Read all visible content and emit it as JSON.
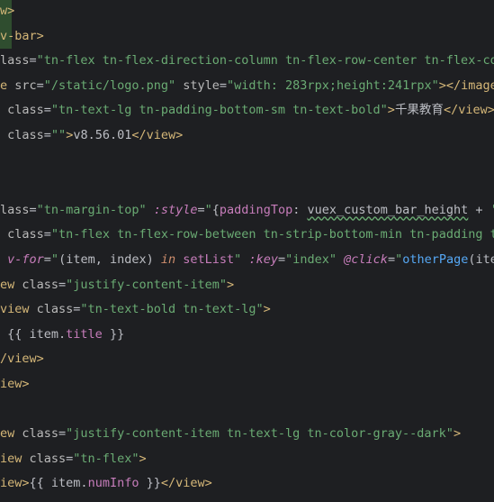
{
  "editor": {
    "lines": [
      {
        "tokens": [
          {
            "t": "w>",
            "c": "tag"
          }
        ]
      },
      {
        "tokens": [
          {
            "t": "v-bar>",
            "c": "tag"
          }
        ]
      },
      {
        "tokens": [
          {
            "t": "lass",
            "c": "attr"
          },
          {
            "t": "=",
            "c": "eq"
          },
          {
            "t": "\"tn-flex tn-flex-direction-column tn-flex-row-center tn-flex-col",
            "c": "str"
          }
        ]
      },
      {
        "tokens": [
          {
            "t": "e ",
            "c": "tag"
          },
          {
            "t": "src",
            "c": "attr"
          },
          {
            "t": "=",
            "c": "eq"
          },
          {
            "t": "\"/static/logo.png\"",
            "c": "str"
          },
          {
            "t": " ",
            "c": "text"
          },
          {
            "t": "style",
            "c": "attr"
          },
          {
            "t": "=",
            "c": "eq"
          },
          {
            "t": "\"width: 283rpx;height:241rpx\"",
            "c": "str"
          },
          {
            "t": "></",
            "c": "tag"
          },
          {
            "t": "image",
            "c": "tag"
          },
          {
            "t": ">",
            "c": "tag"
          }
        ]
      },
      {
        "tokens": [
          {
            "t": " class",
            "c": "attr"
          },
          {
            "t": "=",
            "c": "eq"
          },
          {
            "t": "\"tn-text-lg tn-padding-bottom-sm tn-text-bold\"",
            "c": "str"
          },
          {
            "t": ">",
            "c": "tag"
          },
          {
            "t": "千果教育",
            "c": "text"
          },
          {
            "t": "</",
            "c": "tag"
          },
          {
            "t": "view",
            "c": "tag"
          },
          {
            "t": ">",
            "c": "tag"
          }
        ]
      },
      {
        "tokens": [
          {
            "t": " class",
            "c": "attr"
          },
          {
            "t": "=",
            "c": "eq"
          },
          {
            "t": "\"\"",
            "c": "str"
          },
          {
            "t": ">",
            "c": "tag"
          },
          {
            "t": "v8.56.01",
            "c": "text"
          },
          {
            "t": "</",
            "c": "tag"
          },
          {
            "t": "view",
            "c": "tag"
          },
          {
            "t": ">",
            "c": "tag"
          }
        ]
      },
      {
        "tokens": []
      },
      {
        "tokens": []
      },
      {
        "tokens": [
          {
            "t": "lass",
            "c": "attr"
          },
          {
            "t": "=",
            "c": "eq"
          },
          {
            "t": "\"tn-margin-top\"",
            "c": "str"
          },
          {
            "t": " ",
            "c": "text"
          },
          {
            "t": ":style",
            "c": "vattr"
          },
          {
            "t": "=",
            "c": "eq"
          },
          {
            "t": "\"",
            "c": "str"
          },
          {
            "t": "{",
            "c": "punc"
          },
          {
            "t": "paddingTop",
            "c": "var"
          },
          {
            "t": ": ",
            "c": "punc"
          },
          {
            "t": "vuex_custom_bar_height",
            "c": "text",
            "u": true
          },
          {
            "t": " + ",
            "c": "punc"
          },
          {
            "t": "'p",
            "c": "str"
          }
        ]
      },
      {
        "tokens": [
          {
            "t": " class",
            "c": "attr"
          },
          {
            "t": "=",
            "c": "eq"
          },
          {
            "t": "\"tn-flex tn-flex-row-between tn-strip-bottom-min tn-padding tn",
            "c": "str"
          }
        ]
      },
      {
        "tokens": [
          {
            "t": " v-for",
            "c": "vattr"
          },
          {
            "t": "=",
            "c": "eq"
          },
          {
            "t": "\"",
            "c": "str"
          },
          {
            "t": "(item, index) ",
            "c": "text"
          },
          {
            "t": "in",
            "c": "kw"
          },
          {
            "t": " ",
            "c": "text"
          },
          {
            "t": "setList",
            "c": "var"
          },
          {
            "t": "\"",
            "c": "str"
          },
          {
            "t": " ",
            "c": "text"
          },
          {
            "t": ":key",
            "c": "vattr"
          },
          {
            "t": "=",
            "c": "eq"
          },
          {
            "t": "\"index\"",
            "c": "str"
          },
          {
            "t": " ",
            "c": "text"
          },
          {
            "t": "@click",
            "c": "vattr"
          },
          {
            "t": "=",
            "c": "eq"
          },
          {
            "t": "\"",
            "c": "str"
          },
          {
            "t": "otherPage",
            "c": "fn"
          },
          {
            "t": "(item",
            "c": "text"
          }
        ]
      },
      {
        "tokens": [
          {
            "t": "ew ",
            "c": "tag"
          },
          {
            "t": "class",
            "c": "attr"
          },
          {
            "t": "=",
            "c": "eq"
          },
          {
            "t": "\"justify-content-item\"",
            "c": "str"
          },
          {
            "t": ">",
            "c": "tag"
          }
        ]
      },
      {
        "tokens": [
          {
            "t": "view ",
            "c": "tag"
          },
          {
            "t": "class",
            "c": "attr"
          },
          {
            "t": "=",
            "c": "eq"
          },
          {
            "t": "\"tn-text-bold tn-text-lg\"",
            "c": "str"
          },
          {
            "t": ">",
            "c": "tag"
          }
        ]
      },
      {
        "tokens": [
          {
            "t": " {{ ",
            "c": "punc"
          },
          {
            "t": "item",
            "c": "text"
          },
          {
            "t": ".",
            "c": "punc"
          },
          {
            "t": "title",
            "c": "var"
          },
          {
            "t": " }}",
            "c": "punc"
          }
        ]
      },
      {
        "tokens": [
          {
            "t": "/",
            "c": "tag"
          },
          {
            "t": "view",
            "c": "tag"
          },
          {
            "t": ">",
            "c": "tag"
          }
        ]
      },
      {
        "tokens": [
          {
            "t": "iew>",
            "c": "tag"
          }
        ]
      },
      {
        "tokens": []
      },
      {
        "tokens": [
          {
            "t": "ew ",
            "c": "tag"
          },
          {
            "t": "class",
            "c": "attr"
          },
          {
            "t": "=",
            "c": "eq"
          },
          {
            "t": "\"justify-content-item tn-text-lg tn-color-gray--dark\"",
            "c": "str"
          },
          {
            "t": ">",
            "c": "tag"
          }
        ]
      },
      {
        "tokens": [
          {
            "t": "iew ",
            "c": "tag"
          },
          {
            "t": "class",
            "c": "attr"
          },
          {
            "t": "=",
            "c": "eq"
          },
          {
            "t": "\"tn-flex\"",
            "c": "str"
          },
          {
            "t": ">",
            "c": "tag"
          }
        ]
      },
      {
        "tokens": [
          {
            "t": "iew>",
            "c": "tag"
          },
          {
            "t": "{{ ",
            "c": "punc"
          },
          {
            "t": "item",
            "c": "text"
          },
          {
            "t": ".",
            "c": "punc"
          },
          {
            "t": "numInfo",
            "c": "var"
          },
          {
            "t": " }}",
            "c": "punc"
          },
          {
            "t": "</",
            "c": "tag"
          },
          {
            "t": "view",
            "c": "tag"
          },
          {
            "t": ">",
            "c": "tag"
          }
        ]
      }
    ]
  },
  "colors": {
    "background": "#1e1f22",
    "tag": "#d5b778",
    "string": "#6aab73",
    "vue_attr": "#c77dbb",
    "keyword": "#cf8e6d",
    "function": "#56a8f5",
    "text": "#bcbec4"
  }
}
